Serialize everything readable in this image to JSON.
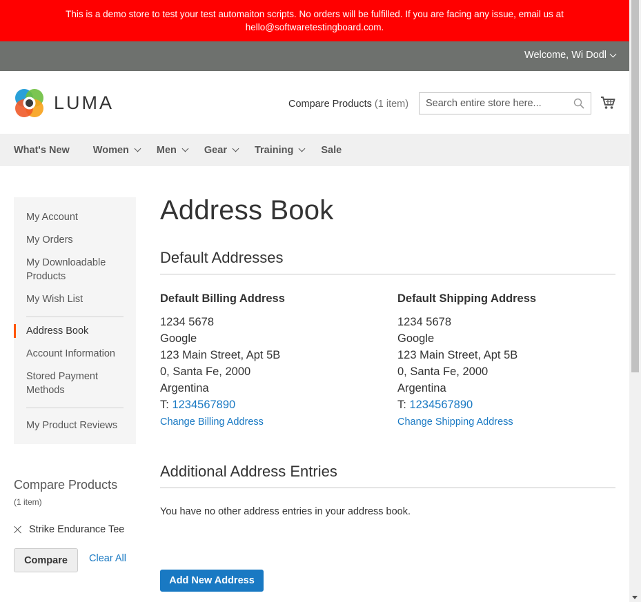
{
  "banner": {
    "text_line1": "This is a demo store to test your test automaiton scripts. No orders will be fulfilled. If you are facing any issue, email us at",
    "text_line2": "hello@softwaretestingboard.com."
  },
  "header": {
    "welcome": "Welcome, Wi Dodl",
    "logo_text": "LUMA",
    "compare_label": "Compare Products",
    "compare_count": "(1 item)",
    "search_placeholder": "Search entire store here..."
  },
  "nav": {
    "items": [
      {
        "label": "What's New",
        "has_dropdown": false
      },
      {
        "label": "Women",
        "has_dropdown": true
      },
      {
        "label": "Men",
        "has_dropdown": true
      },
      {
        "label": "Gear",
        "has_dropdown": true
      },
      {
        "label": "Training",
        "has_dropdown": true
      },
      {
        "label": "Sale",
        "has_dropdown": false
      }
    ]
  },
  "sidebar": {
    "items": [
      {
        "label": "My Account"
      },
      {
        "label": "My Orders"
      },
      {
        "label": "My Downloadable Products"
      },
      {
        "label": "My Wish List"
      },
      {
        "label": "Address Book",
        "current": true
      },
      {
        "label": "Account Information"
      },
      {
        "label": "Stored Payment Methods"
      },
      {
        "label": "My Product Reviews"
      }
    ],
    "compare": {
      "title": "Compare Products",
      "count": "(1 item)",
      "product": "Strike Endurance Tee",
      "compare_button": "Compare",
      "clear_all": "Clear All"
    }
  },
  "main": {
    "title": "Address Book",
    "default_section_title": "Default Addresses",
    "billing": {
      "title": "Default Billing Address",
      "name": "1234 5678",
      "company": "Google",
      "street": "123 Main Street, Apt 5B",
      "city_line": "0, Santa Fe, 2000",
      "country": "Argentina",
      "tel_prefix": "T:",
      "tel": "1234567890",
      "change_link": "Change Billing Address"
    },
    "shipping": {
      "title": "Default Shipping Address",
      "name": "1234 5678",
      "company": "Google",
      "street": "123 Main Street, Apt 5B",
      "city_line": "0, Santa Fe, 2000",
      "country": "Argentina",
      "tel_prefix": "T:",
      "tel": "1234567890",
      "change_link": "Change Shipping Address"
    },
    "additional_section_title": "Additional Address Entries",
    "empty_message": "You have no other address entries in your address book.",
    "add_button": "Add New Address"
  },
  "colors": {
    "banner": "#ff0000",
    "panel": "#6e716e",
    "link": "#1979c3",
    "primary_button": "#1979c3",
    "current_marker": "#ff5501"
  }
}
